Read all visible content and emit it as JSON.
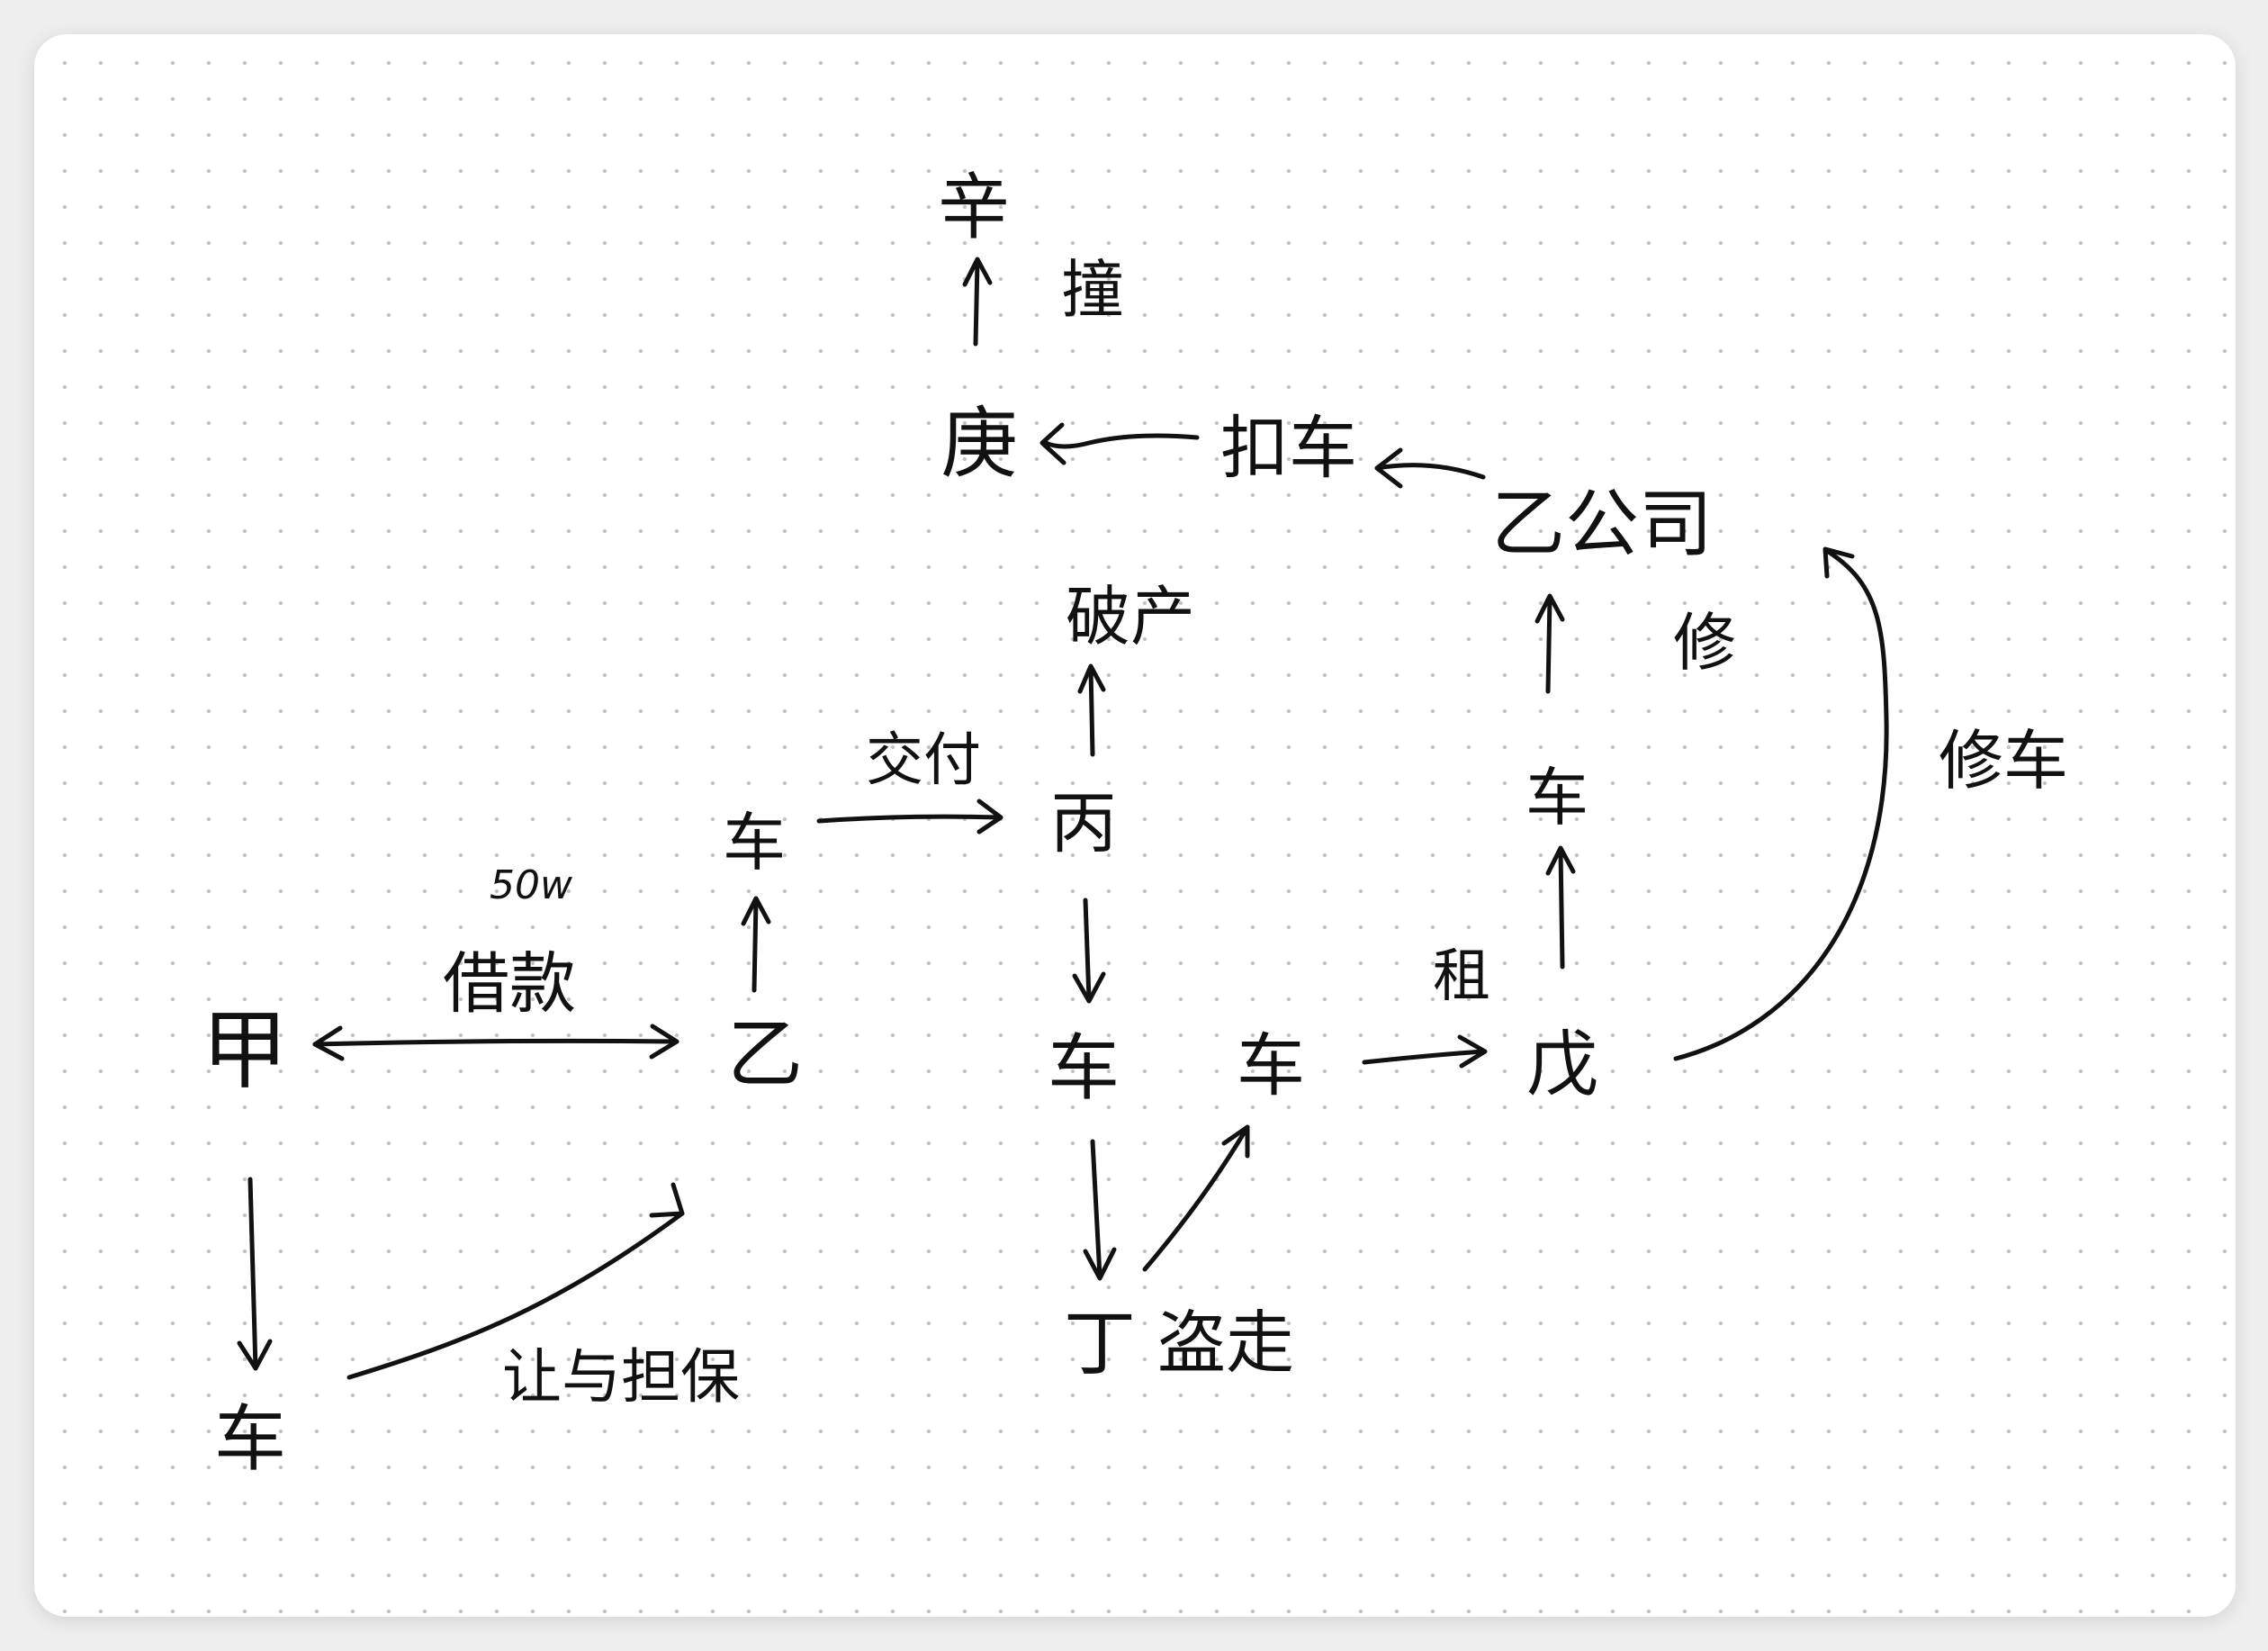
{
  "colors": {
    "ink": "#111111",
    "paper": "#ffffff",
    "background": "#eeeeee",
    "grid_dot": "#c4c4c4"
  },
  "nodes": {
    "jia": "甲",
    "yi": "乙",
    "che_jia": "车",
    "che_yi": "车",
    "bing": "丙",
    "che_bing": "车",
    "ding": "丁",
    "che_ding": "车",
    "wu": "戊",
    "che_wu": "车",
    "yi_company": "乙公司",
    "kou_che": "扣车",
    "geng": "庚",
    "xin": "辛",
    "po_chan": "破产"
  },
  "edge_labels": {
    "amount": "50w",
    "loan": "借款",
    "transfer_guarantee": "让与担保",
    "deliver": "交付",
    "steal": "盗走",
    "rent": "租",
    "repair": "修",
    "repair_car": "修车",
    "crash": "撞"
  }
}
